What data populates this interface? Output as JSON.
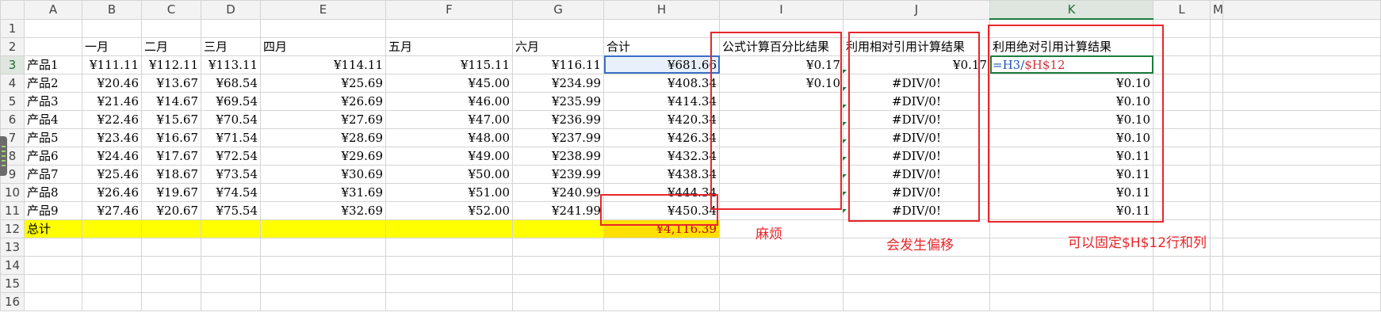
{
  "columns": [
    "A",
    "B",
    "C",
    "D",
    "E",
    "F",
    "G",
    "H",
    "I",
    "J",
    "K",
    "L",
    "M"
  ],
  "active_column": "K",
  "active_row": "3",
  "row_numbers": [
    "1",
    "2",
    "3",
    "4",
    "5",
    "6",
    "7",
    "8",
    "9",
    "10",
    "11",
    "12",
    "13",
    "14",
    "15",
    "16"
  ],
  "header_row": [
    "一月",
    "二月",
    "三月",
    "四月",
    "五月",
    "六月",
    "合计",
    "公式计算百分比结果",
    "利用相对引用计算结果",
    "利用绝对引用计算结果"
  ],
  "products": [
    {
      "name": "产品1",
      "b": "¥111.11",
      "c": "¥112.11",
      "d": "¥113.11",
      "e": "¥114.11",
      "f": "¥115.11",
      "g": "¥116.11",
      "h": "¥681.66",
      "i": "¥0.17",
      "j": "¥0.17",
      "k": ""
    },
    {
      "name": "产品2",
      "b": "¥20.46",
      "c": "¥13.67",
      "d": "¥68.54",
      "e": "¥25.69",
      "f": "¥45.00",
      "g": "¥234.99",
      "h": "¥408.34",
      "i": "¥0.10",
      "j": "#DIV/0!",
      "k": "¥0.10"
    },
    {
      "name": "产品3",
      "b": "¥21.46",
      "c": "¥14.67",
      "d": "¥69.54",
      "e": "¥26.69",
      "f": "¥46.00",
      "g": "¥235.99",
      "h": "¥414.34",
      "i": "",
      "j": "#DIV/0!",
      "k": "¥0.10"
    },
    {
      "name": "产品4",
      "b": "¥22.46",
      "c": "¥15.67",
      "d": "¥70.54",
      "e": "¥27.69",
      "f": "¥47.00",
      "g": "¥236.99",
      "h": "¥420.34",
      "i": "",
      "j": "#DIV/0!",
      "k": "¥0.10"
    },
    {
      "name": "产品5",
      "b": "¥23.46",
      "c": "¥16.67",
      "d": "¥71.54",
      "e": "¥28.69",
      "f": "¥48.00",
      "g": "¥237.99",
      "h": "¥426.34",
      "i": "",
      "j": "#DIV/0!",
      "k": "¥0.10"
    },
    {
      "name": "产品6",
      "b": "¥24.46",
      "c": "¥17.67",
      "d": "¥72.54",
      "e": "¥29.69",
      "f": "¥49.00",
      "g": "¥238.99",
      "h": "¥432.34",
      "i": "",
      "j": "#DIV/0!",
      "k": "¥0.11"
    },
    {
      "name": "产品7",
      "b": "¥25.46",
      "c": "¥18.67",
      "d": "¥73.54",
      "e": "¥30.69",
      "f": "¥50.00",
      "g": "¥239.99",
      "h": "¥438.34",
      "i": "",
      "j": "#DIV/0!",
      "k": "¥0.11"
    },
    {
      "name": "产品8",
      "b": "¥26.46",
      "c": "¥19.67",
      "d": "¥74.54",
      "e": "¥31.69",
      "f": "¥51.00",
      "g": "¥240.99",
      "h": "¥444.34",
      "i": "",
      "j": "#DIV/0!",
      "k": "¥0.11"
    },
    {
      "name": "产品9",
      "b": "¥27.46",
      "c": "¥20.67",
      "d": "¥75.54",
      "e": "¥32.69",
      "f": "¥52.00",
      "g": "¥241.99",
      "h": "¥450.34",
      "i": "",
      "j": "#DIV/0!",
      "k": "¥0.11"
    }
  ],
  "formula_k3": {
    "prefix": "=",
    "rel_ref": "H3",
    "sep": "/",
    "abs_ref": "$H$12"
  },
  "total_row": {
    "label": "总计",
    "value": "¥4,116.39"
  },
  "annotations": {
    "trouble": "麻烦",
    "shift": "会发生偏移",
    "fixed": "可以固定$H$12行和列"
  },
  "colors": {
    "highlight": "#ffff00",
    "total_fill": "#ffe000",
    "annotation_red": "#e8262b",
    "selection_blue": "#3b6fc4",
    "edit_green": "#1e7b3e"
  }
}
